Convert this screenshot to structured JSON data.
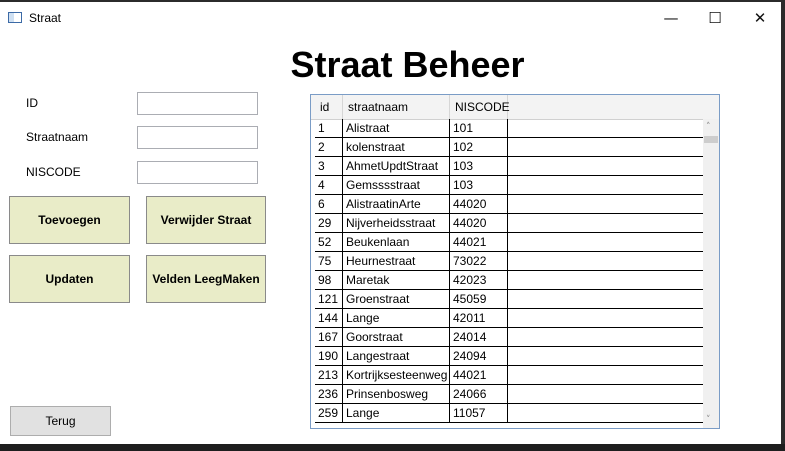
{
  "window": {
    "title": "Straat",
    "minimize_glyph": "—",
    "maximize_glyph": "☐",
    "close_glyph": "✕"
  },
  "page": {
    "title": "Straat Beheer"
  },
  "form": {
    "id_label": "ID",
    "id_value": "",
    "straatnaam_label": "Straatnaam",
    "straatnaam_value": "",
    "niscode_label": "NISCODE",
    "niscode_value": ""
  },
  "buttons": {
    "toevoegen": "Toevoegen",
    "verwijder": "Verwijder Straat",
    "updaten": "Updaten",
    "velden_leegmaken": "Velden LeegMaken",
    "terug": "Terug"
  },
  "grid": {
    "columns": [
      "id",
      "straatnaam",
      "NISCODE"
    ],
    "rows": [
      [
        "1",
        "Alistraat",
        "101"
      ],
      [
        "2",
        "kolenstraat",
        "102"
      ],
      [
        "3",
        "AhmetUpdtStraat",
        "103"
      ],
      [
        "4",
        "Gemsssstraat",
        "103"
      ],
      [
        "6",
        "AlistraatinArte",
        "44020"
      ],
      [
        "29",
        "Nijverheidsstraat",
        "44020"
      ],
      [
        "52",
        "Beukenlaan",
        "44021"
      ],
      [
        "75",
        "Heurnestraat",
        "73022"
      ],
      [
        "98",
        "Maretak",
        "42023"
      ],
      [
        "121",
        "Groenstraat",
        "45059"
      ],
      [
        "144",
        "Lange",
        "42011"
      ],
      [
        "167",
        "Goorstraat",
        "24014"
      ],
      [
        "190",
        "Langestraat",
        "24094"
      ],
      [
        "213",
        "Kortrijksesteenweg",
        "44021"
      ],
      [
        "236",
        "Prinsenbosweg",
        "24066"
      ],
      [
        "259",
        "Lange",
        "11057"
      ]
    ],
    "scroll_up_glyph": "˄",
    "scroll_down_glyph": "˅"
  }
}
